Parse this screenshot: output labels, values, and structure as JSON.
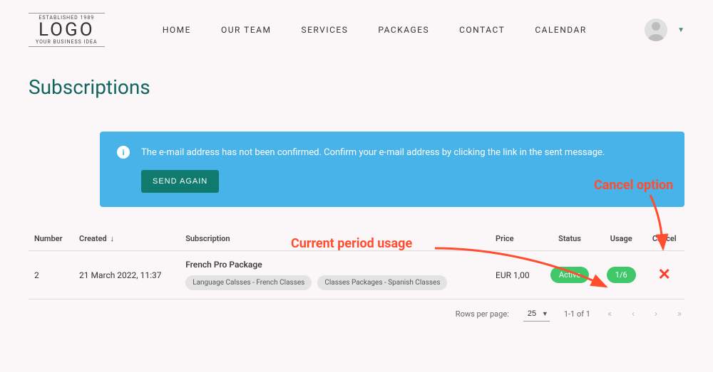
{
  "logo": {
    "est": "ESTABLISHED 1989",
    "main": "LOGO",
    "sub": "YOUR BUSINESS IDEA"
  },
  "nav": [
    "HOME",
    "OUR TEAM",
    "SERVICES",
    "PACKAGES",
    "CONTACT",
    "CALENDAR"
  ],
  "page_title": "Subscriptions",
  "alert": {
    "text": "The e-mail address has not been confirmed. Confirm your e-mail address by clicking the link in the sent message.",
    "button": "SEND AGAIN"
  },
  "table": {
    "headers": {
      "number": "Number",
      "created": "Created",
      "subscription": "Subscription",
      "price": "Price",
      "status": "Status",
      "usage": "Usage",
      "cancel": "Cancel"
    },
    "sort_indicator": "↓",
    "rows": [
      {
        "number": "2",
        "created": "21 March 2022, 11:37",
        "package": "French Pro Package",
        "tags": [
          "Language Calsses - French Classes",
          "Classes Packages - Spanish Classes"
        ],
        "price": "EUR 1,00",
        "status": "Active",
        "usage": "1/6"
      }
    ]
  },
  "pager": {
    "rpp_label": "Rows per page:",
    "rpp_value": "25",
    "range": "1-1 of 1"
  },
  "annotations": {
    "usage": "Current period usage",
    "cancel": "Cancel option"
  }
}
